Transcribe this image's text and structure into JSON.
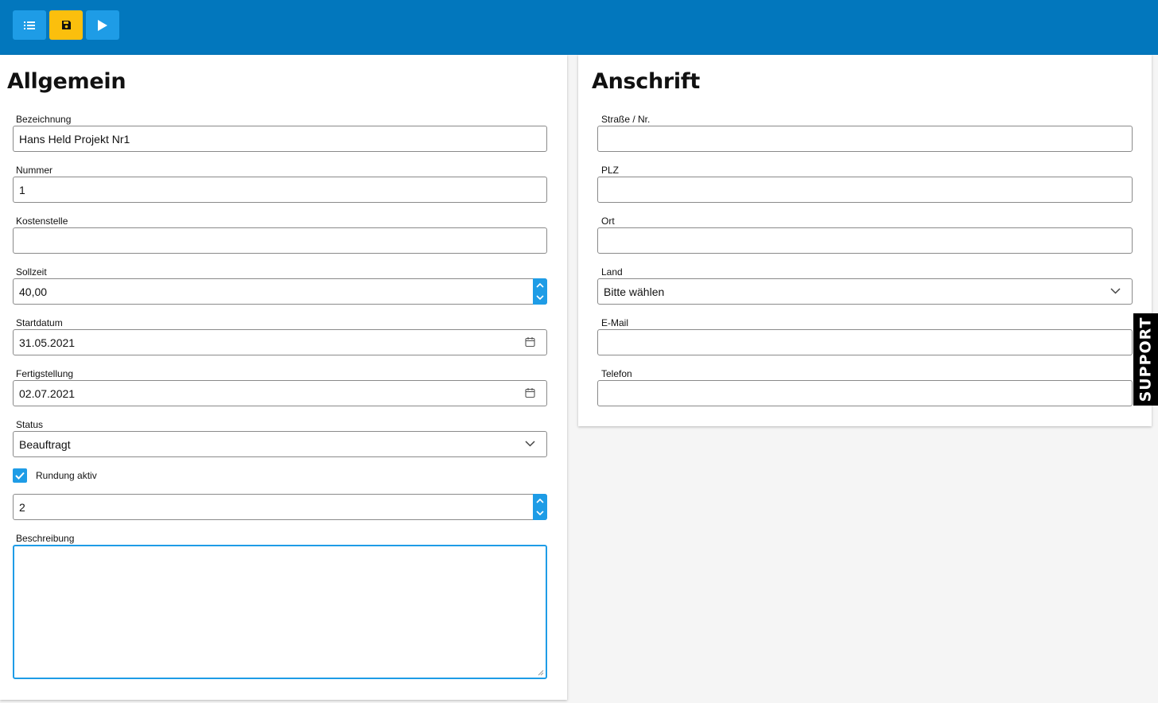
{
  "toolbar": {
    "list_icon": "list-icon",
    "save_icon": "save-icon",
    "run_icon": "play-icon",
    "colors": {
      "bar": "#0277bd",
      "blue_button": "#1e9ce6",
      "yellow_button": "#fbbf0d"
    }
  },
  "allgemein": {
    "title": "Allgemein",
    "bezeichnung": {
      "label": "Bezeichnung",
      "value": "Hans Held Projekt Nr1"
    },
    "nummer": {
      "label": "Nummer",
      "value": "1"
    },
    "kostenstelle": {
      "label": "Kostenstelle",
      "value": ""
    },
    "sollzeit": {
      "label": "Sollzeit",
      "value": "40,00"
    },
    "startdatum": {
      "label": "Startdatum",
      "value": "31.05.2021"
    },
    "fertigstellung": {
      "label": "Fertigstellung",
      "value": "02.07.2021"
    },
    "status": {
      "label": "Status",
      "value": "Beauftragt"
    },
    "rundung": {
      "label": "Rundung aktiv",
      "checked": true,
      "value": "2"
    },
    "beschreibung": {
      "label": "Beschreibung",
      "value": ""
    }
  },
  "anschrift": {
    "title": "Anschrift",
    "strasse": {
      "label": "Straße / Nr.",
      "value": ""
    },
    "plz": {
      "label": "PLZ",
      "value": ""
    },
    "ort": {
      "label": "Ort",
      "value": ""
    },
    "land": {
      "label": "Land",
      "value": "Bitte wählen"
    },
    "email": {
      "label": "E-Mail",
      "value": ""
    },
    "telefon": {
      "label": "Telefon",
      "value": ""
    }
  },
  "support": {
    "label": "SUPPORT"
  }
}
